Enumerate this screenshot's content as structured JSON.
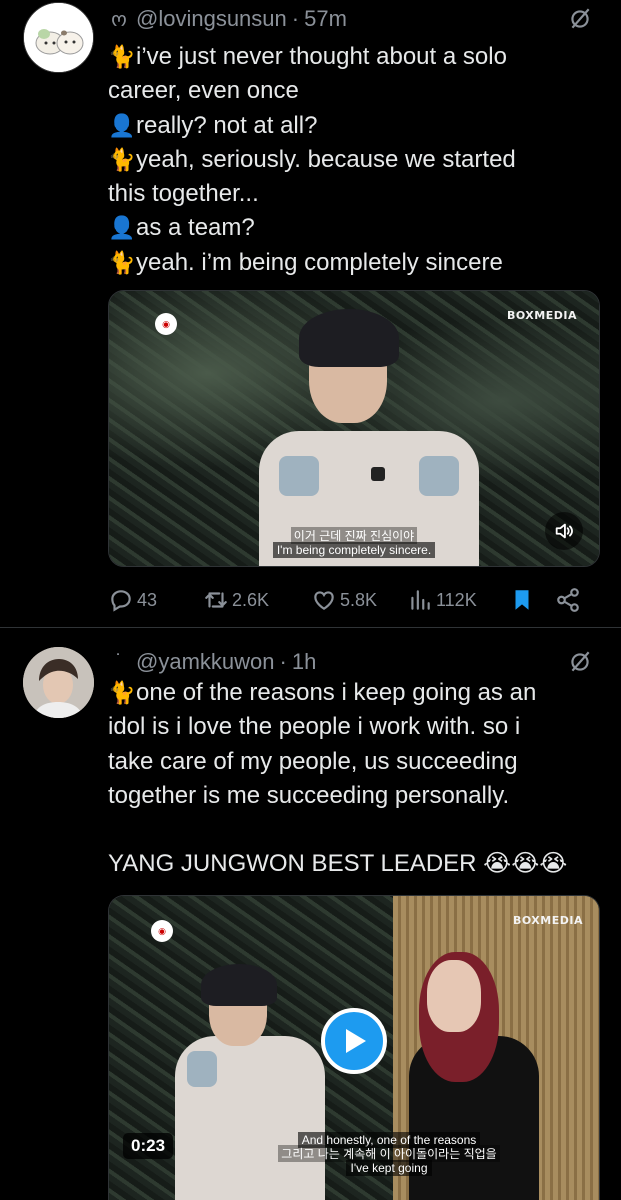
{
  "tweets": [
    {
      "handle_prefix": "ო",
      "handle": "@lovingsunsun",
      "separator": "·",
      "time": "57m",
      "lines": [
        {
          "emoji": "🐈",
          "text": "i’ve just never thought about a solo"
        },
        {
          "emoji": "",
          "text": "career, even once"
        },
        {
          "emoji": "👤",
          "text": "really? not at all?"
        },
        {
          "emoji": "🐈",
          "text": "yeah, seriously. because we started"
        },
        {
          "emoji": "",
          "text": "this together..."
        },
        {
          "emoji": "👤",
          "text": "as a team?"
        },
        {
          "emoji": "🐈",
          "text": "yeah. i’m being completely sincere"
        }
      ],
      "media": {
        "watermark": "BOXMEDIA",
        "subtitle_ko": "이거 근데 진짜 진심이야",
        "subtitle_en": "I'm being completely sincere."
      },
      "stats": {
        "replies": "43",
        "reposts": "2.6K",
        "likes": "5.8K",
        "views": "112K"
      }
    },
    {
      "handle_prefix": "˙",
      "handle": "@yamkkuwon",
      "separator": "·",
      "time": "1h",
      "lines": [
        {
          "emoji": "🐈",
          "text": "one of the reasons i keep going as an"
        },
        {
          "emoji": "",
          "text": "idol is i love the people i work with. so i"
        },
        {
          "emoji": "",
          "text": "take care of my people, us succeeding"
        },
        {
          "emoji": "",
          "text": "together is me succeeding personally."
        }
      ],
      "closing": "YANG JUNGWON BEST LEADER 😭😭😭",
      "media": {
        "watermark": "BOXMEDIA",
        "duration": "0:23",
        "subtitle_ko": "그리고 나는 계속해 이 아이돌이라는 직업을",
        "subtitle_en_1": "And honestly, one of the reasons",
        "subtitle_en_2": "I've kept going"
      }
    }
  ],
  "colors": {
    "background": "#000000",
    "text": "#e7e9ea",
    "muted": "#8b9199",
    "accent": "#1d9bf0",
    "divider": "#2f3336"
  },
  "icons": [
    "grok-icon",
    "reply-icon",
    "retweet-icon",
    "like-icon",
    "views-icon",
    "bookmark-icon",
    "share-icon",
    "volume-icon",
    "play-icon"
  ]
}
